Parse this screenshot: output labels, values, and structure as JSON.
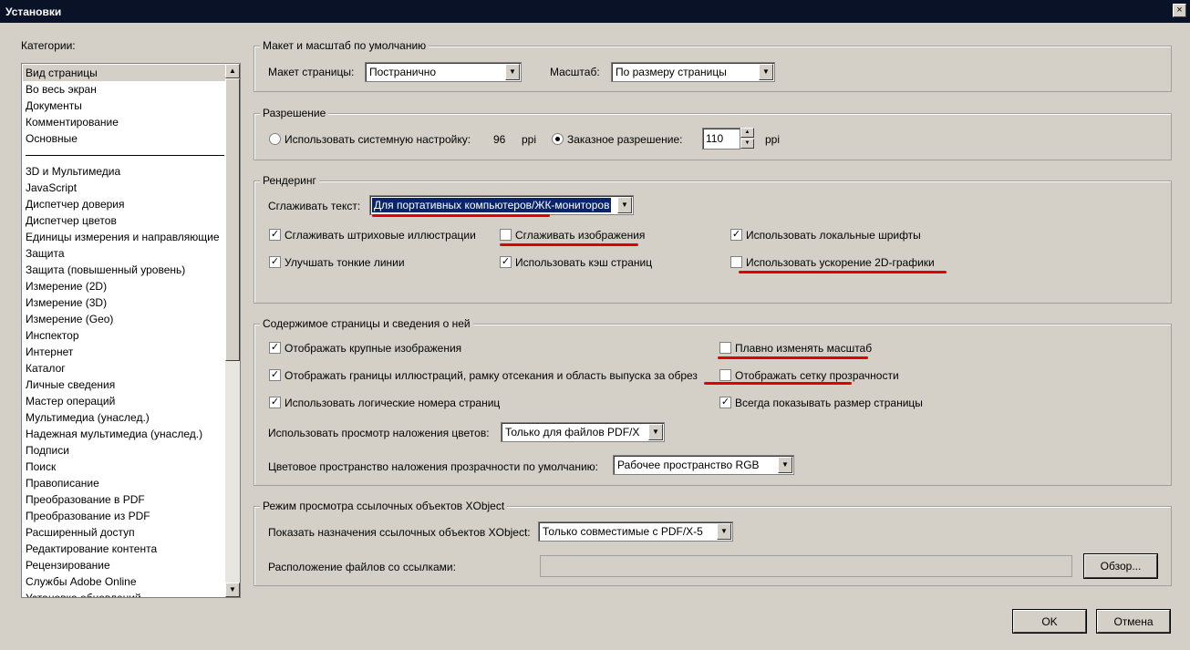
{
  "window": {
    "title": "Установки",
    "close_glyph": "×"
  },
  "categories": {
    "label": "Категории:",
    "group1": [
      "Вид страницы",
      "Во весь экран",
      "Документы",
      "Комментирование",
      "Основные"
    ],
    "group2": [
      "3D и Мультимедиа",
      "JavaScript",
      "Диспетчер доверия",
      "Диспетчер цветов",
      "Единицы измерения и направляющие",
      "Защита",
      "Защита (повышенный уровень)",
      "Измерение (2D)",
      "Измерение (3D)",
      "Измерение (Geo)",
      "Инспектор",
      "Интернет",
      "Каталог",
      "Личные сведения",
      "Мастер операций",
      "Мультимедиа (унаслед.)",
      "Надежная мультимедиа (унаслед.)",
      "Подписи",
      "Поиск",
      "Правописание",
      "Преобразование в PDF",
      "Преобразование из PDF",
      "Расширенный доступ",
      "Редактирование контента",
      "Рецензирование",
      "Службы Adobe Online",
      "Установка обновлений"
    ],
    "selected": "Вид страницы"
  },
  "layout": {
    "title": "Макет и масштаб по умолчанию",
    "page_layout_label": "Макет страницы:",
    "page_layout_value": "Постранично",
    "zoom_label": "Масштаб:",
    "zoom_value": "По размеру страницы"
  },
  "resolution": {
    "title": "Разрешение",
    "system_label": "Использовать системную настройку:",
    "system_value": "96",
    "system_unit": "ppi",
    "custom_label": "Заказное разрешение:",
    "custom_value": "110",
    "custom_unit": "ppi",
    "selected": "custom"
  },
  "rendering": {
    "title": "Рендеринг",
    "smooth_text_label": "Сглаживать текст:",
    "smooth_text_value": "Для портативных компьютеров/ЖК-мониторов",
    "smooth_line_art": {
      "label": "Сглаживать штриховые иллюстрации",
      "checked": true
    },
    "enhance_thin_lines": {
      "label": "Улучшать тонкие линии",
      "checked": true
    },
    "smooth_images": {
      "label": "Сглаживать изображения",
      "checked": false
    },
    "use_page_cache": {
      "label": "Использовать кэш страниц",
      "checked": true
    },
    "use_local_fonts": {
      "label": "Использовать локальные шрифты",
      "checked": true
    },
    "use_2d_acceleration": {
      "label": "Использовать ускорение 2D-графики",
      "checked": false
    }
  },
  "page_content": {
    "title": "Содержимое страницы и сведения о ней",
    "show_large_images": {
      "label": "Отображать крупные изображения",
      "checked": true
    },
    "show_art_trim_bleed": {
      "label": "Отображать границы иллюстраций, рамку отсекания и область выпуска за обрез",
      "checked": true
    },
    "use_logical_page_numbers": {
      "label": "Использовать логические номера страниц",
      "checked": true
    },
    "smooth_zoom": {
      "label": "Плавно изменять масштаб",
      "checked": false
    },
    "show_transparency_grid": {
      "label": "Отображать сетку прозрачности",
      "checked": false
    },
    "always_show_page_size": {
      "label": "Всегда показывать размер страницы",
      "checked": true
    },
    "overprint_preview_label": "Использовать просмотр наложения цветов:",
    "overprint_preview_value": "Только для файлов PDF/X",
    "blend_space_label": "Цветовое пространство наложения прозрачности по умолчанию:",
    "blend_space_value": "Рабочее пространство RGB"
  },
  "xobject": {
    "title": "Режим просмотра ссылочных объектов XObject",
    "show_targets_label": "Показать назначения ссылочных объектов XObject:",
    "show_targets_value": "Только совместимые с PDF/X-5",
    "location_label": "Расположение файлов со ссылками:",
    "location_value": "",
    "browse_label": "Обзор..."
  },
  "buttons": {
    "ok": "OK",
    "cancel": "Отмена"
  },
  "glyphs": {
    "check": "✓",
    "arrow_down": "▼",
    "arrow_up": "▲"
  },
  "colors": {
    "annotation_red": "#e00000",
    "selection_blue": "#0a246a",
    "titlebar": "#0a1228"
  }
}
